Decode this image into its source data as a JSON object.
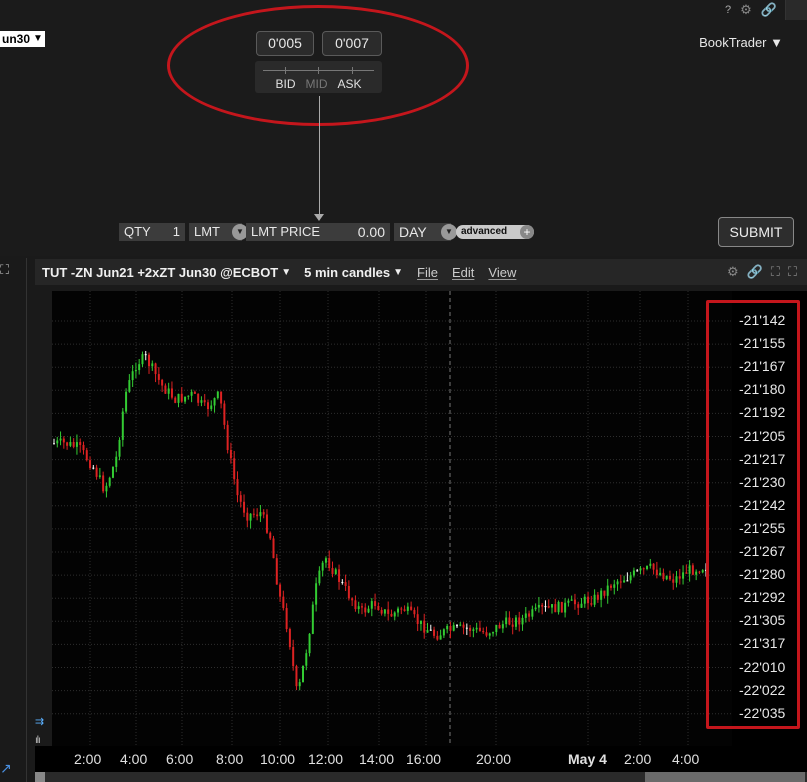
{
  "top_panel": {
    "help_icon": "?",
    "symbol_fragment": "un30",
    "bid_price": "0'005",
    "ask_price": "0'007",
    "scale_labels": {
      "bid": "BID",
      "mid": "MID",
      "ask": "ASK"
    },
    "book_trader": "BookTrader",
    "order_bar": {
      "qty_label": "QTY",
      "qty_value": "1",
      "order_type": "LMT",
      "lmt_price_label": "LMT PRICE",
      "lmt_price_value": "0.00",
      "tif": "DAY",
      "advanced": "advanced"
    },
    "submit": "SUBMIT",
    "annotation_color": "#c4161c"
  },
  "chart_window": {
    "title": "TUT -ZN Jun21 +2xZT Jun30 @ECBOT",
    "period": "5 min candles",
    "menu": {
      "file": "File",
      "edit": "Edit",
      "view": "View"
    }
  },
  "chart_data": {
    "type": "candlestick",
    "x_ticks": [
      "2:00",
      "4:00",
      "6:00",
      "8:00",
      "10:00",
      "12:00",
      "14:00",
      "16:00",
      "20:00",
      "May 4",
      "2:00",
      "4:00"
    ],
    "y_ticks": [
      "-21'142",
      "-21'155",
      "-21'167",
      "-21'180",
      "-21'192",
      "-21'205",
      "-21'217",
      "-21'230",
      "-21'242",
      "-21'255",
      "-21'267",
      "-21'280",
      "-21'292",
      "-21'305",
      "-21'317",
      "-22'010",
      "-22'022",
      "-22'035"
    ],
    "y_range_ticks": [
      0,
      17
    ],
    "up_color": "#33cc33",
    "down_color": "#dd2222",
    "grid": true,
    "session_divider_after_x_tick": "16:00",
    "close_path_ticks": [
      [
        0,
        5.3
      ],
      [
        0.5,
        5.3
      ],
      [
        1.1,
        5.5
      ],
      [
        1.7,
        6.3
      ],
      [
        2.2,
        7.3
      ],
      [
        2.7,
        6.0
      ],
      [
        3.1,
        3.2
      ],
      [
        3.6,
        1.8
      ],
      [
        4.0,
        1.6
      ],
      [
        4.7,
        2.8
      ],
      [
        5.3,
        3.4
      ],
      [
        6.0,
        3.2
      ],
      [
        6.6,
        3.8
      ],
      [
        7.2,
        3.2
      ],
      [
        7.6,
        5.6
      ],
      [
        8.0,
        7.6
      ],
      [
        8.4,
        8.4
      ],
      [
        9.0,
        8.3
      ],
      [
        9.4,
        9.2
      ],
      [
        9.8,
        11.8
      ],
      [
        10.2,
        13.4
      ],
      [
        10.6,
        16.3
      ],
      [
        11.0,
        14.2
      ],
      [
        11.4,
        11.6
      ],
      [
        11.8,
        10.2
      ],
      [
        12.3,
        11.0
      ],
      [
        12.8,
        11.8
      ],
      [
        13.4,
        12.6
      ],
      [
        14.0,
        12.2
      ],
      [
        14.6,
        12.8
      ],
      [
        15.2,
        12.4
      ],
      [
        15.8,
        13.0
      ],
      [
        16.6,
        13.6
      ],
      [
        17.2,
        13.4
      ],
      [
        18.0,
        13.3
      ],
      [
        18.8,
        13.5
      ],
      [
        19.6,
        13.1
      ],
      [
        20.4,
        12.9
      ],
      [
        21.2,
        12.5
      ],
      [
        22.0,
        12.4
      ],
      [
        22.8,
        12.2
      ],
      [
        23.6,
        12.0
      ],
      [
        24.4,
        11.3
      ],
      [
        25.2,
        11.0
      ],
      [
        26.0,
        10.7
      ],
      [
        27.0,
        11.2
      ],
      [
        27.6,
        10.8
      ],
      [
        28.4,
        10.6
      ]
    ]
  }
}
